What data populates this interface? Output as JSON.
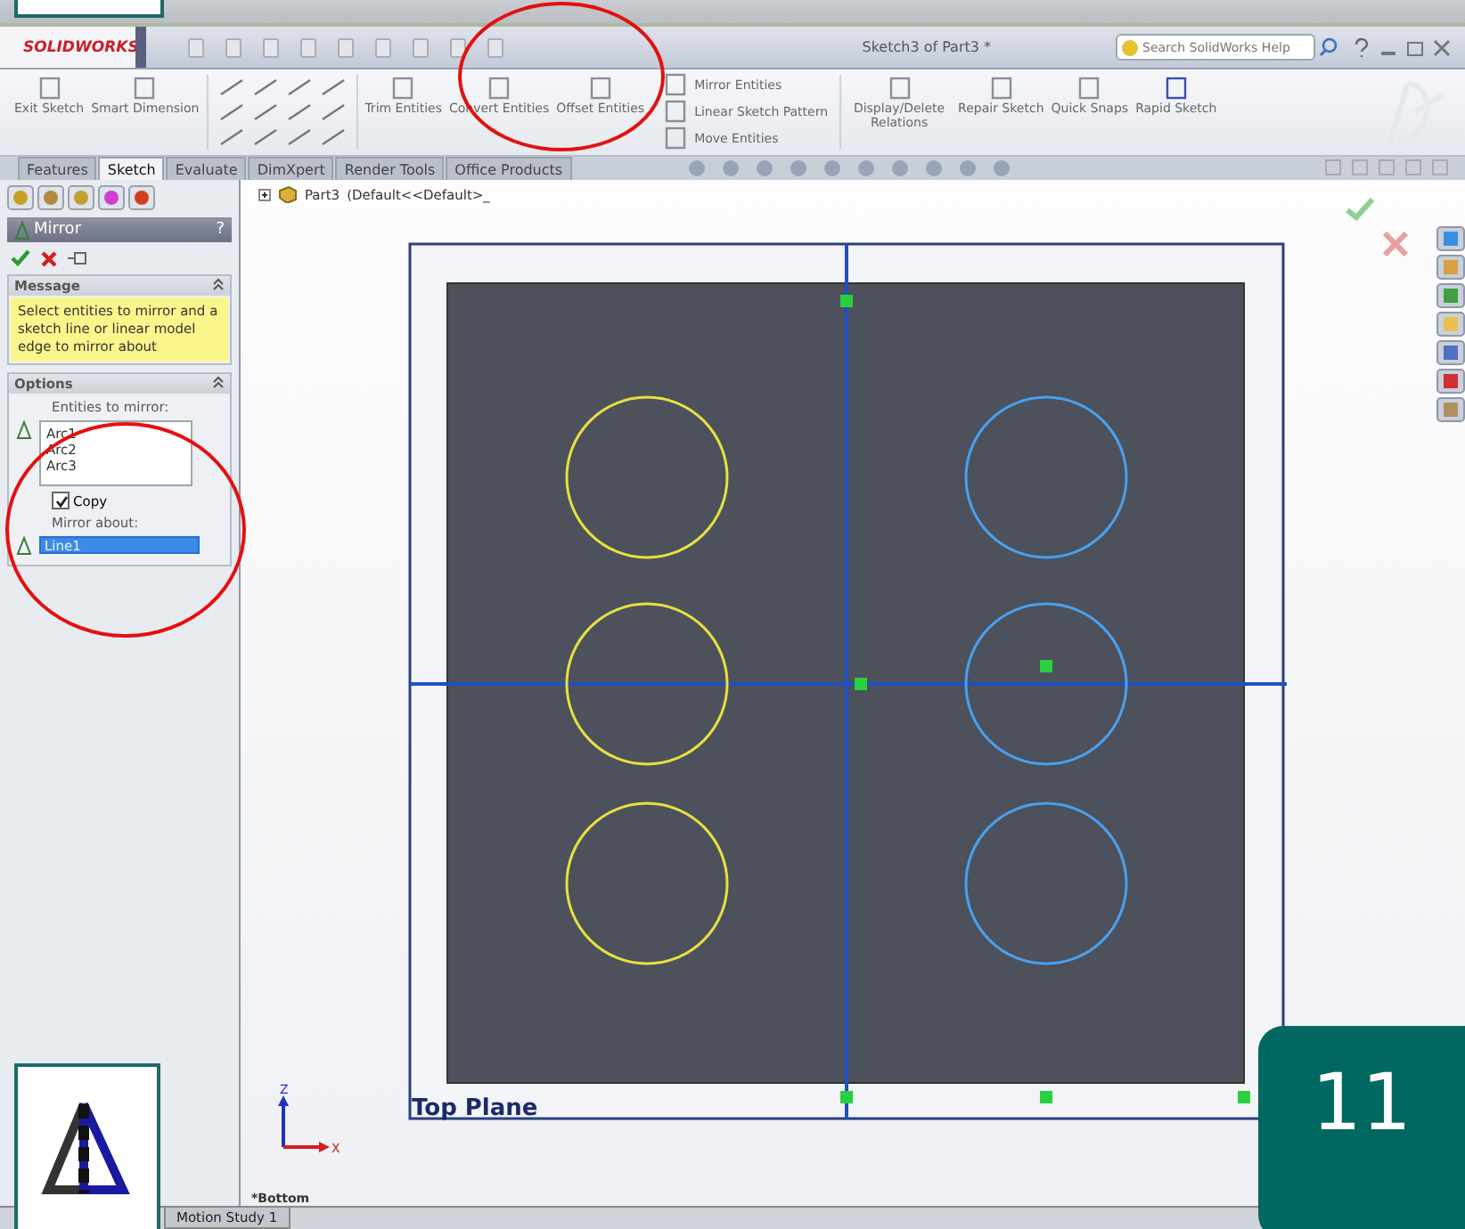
{
  "app": {
    "logo": "SOLIDWORKS",
    "title": "Sketch3 of Part3 *",
    "search": {
      "placeholder": "Search SolidWorks Help"
    }
  },
  "command_manager": {
    "left": [
      {
        "label": "Exit Sketch"
      },
      {
        "label": "Smart Dimension"
      }
    ],
    "middle": [
      {
        "label": "Trim Entities"
      },
      {
        "label": "Convert Entities"
      },
      {
        "label": "Offset Entities"
      }
    ],
    "mirror_group": [
      {
        "label": "Mirror Entities"
      },
      {
        "label": "Linear Sketch Pattern"
      },
      {
        "label": "Move Entities"
      }
    ],
    "right": [
      {
        "label": "Display/Delete Relations"
      },
      {
        "label": "Repair Sketch"
      },
      {
        "label": "Quick Snaps"
      },
      {
        "label": "Rapid Sketch"
      }
    ]
  },
  "tabs": [
    {
      "label": "Features",
      "selected": false
    },
    {
      "label": "Sketch",
      "selected": true
    },
    {
      "label": "Evaluate",
      "selected": false
    },
    {
      "label": "DimXpert",
      "selected": false
    },
    {
      "label": "Render Tools",
      "selected": false
    },
    {
      "label": "Office Products",
      "selected": false
    }
  ],
  "property_manager": {
    "title": "Mirror",
    "help": "?",
    "message": {
      "heading": "Message",
      "text": "Select entities to mirror and a sketch line or linear model edge to mirror about"
    },
    "options": {
      "heading": "Options",
      "entities_label": "Entities to mirror:",
      "entities": [
        "Arc1",
        "Arc2",
        "Arc3"
      ],
      "copy": {
        "label": "Copy",
        "checked": true
      },
      "mirror_about_label": "Mirror about:",
      "mirror_about": "Line1"
    }
  },
  "tree": {
    "part": "Part3",
    "config": "(Default<<Default>_"
  },
  "graphics": {
    "plane_label": "Top Plane",
    "view_label": "*Bottom",
    "triad": {
      "z": "Z",
      "x": "X"
    },
    "circles": [
      {
        "highlighted": true
      },
      {
        "highlighted": true
      },
      {
        "highlighted": true
      },
      {
        "highlighted": false
      },
      {
        "highlighted": false
      },
      {
        "highlighted": false
      }
    ]
  },
  "motion_tab": "Motion Study 1",
  "step_badge": "11"
}
